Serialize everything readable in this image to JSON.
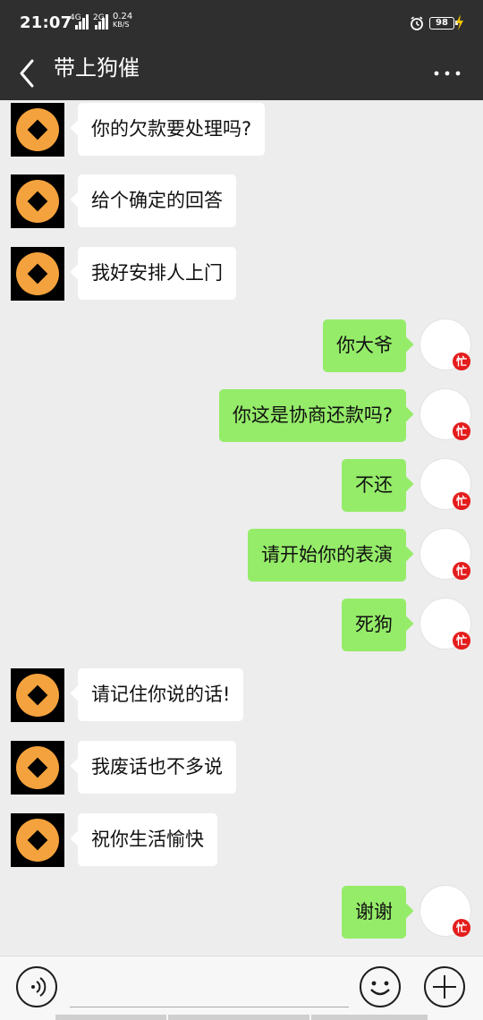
{
  "status_bar": {
    "time": "21:07",
    "network_1": "4G",
    "network_2": "2G",
    "speed_value": "0.24",
    "speed_unit": "KB/S",
    "battery": "98"
  },
  "header": {
    "title": "带上狗催"
  },
  "chat": {
    "messages": [
      {
        "side": "left",
        "text": "你的欠款要处理吗?"
      },
      {
        "side": "left",
        "text": "给个确定的回答"
      },
      {
        "side": "left",
        "text": "我好安排人上门"
      },
      {
        "side": "right",
        "text": "你大爷"
      },
      {
        "side": "right",
        "text": "你这是协商还款吗?"
      },
      {
        "side": "right",
        "text": "不还"
      },
      {
        "side": "right",
        "text": "请开始你的表演"
      },
      {
        "side": "right",
        "text": "死狗"
      },
      {
        "side": "left",
        "text": "请记住你说的话!"
      },
      {
        "side": "left",
        "text": "我废话也不多说"
      },
      {
        "side": "left",
        "text": "祝你生活愉快"
      },
      {
        "side": "right",
        "text": "谢谢"
      }
    ],
    "self_avatar_badge": "忙"
  },
  "colors": {
    "header_bg": "#2f2f2f",
    "chat_bg": "#ededed",
    "incoming_bubble": "#ffffff",
    "outgoing_bubble": "#95ec69",
    "avatar_coin": "#f4a23d",
    "badge_red": "#e41c1c"
  },
  "icons": {
    "back": "chevron-left-icon",
    "more": "more-horizontal-icon",
    "voice": "voice-icon",
    "emoji": "emoji-icon",
    "add": "plus-icon",
    "alarm": "alarm-icon",
    "bolt": "charging-icon"
  }
}
